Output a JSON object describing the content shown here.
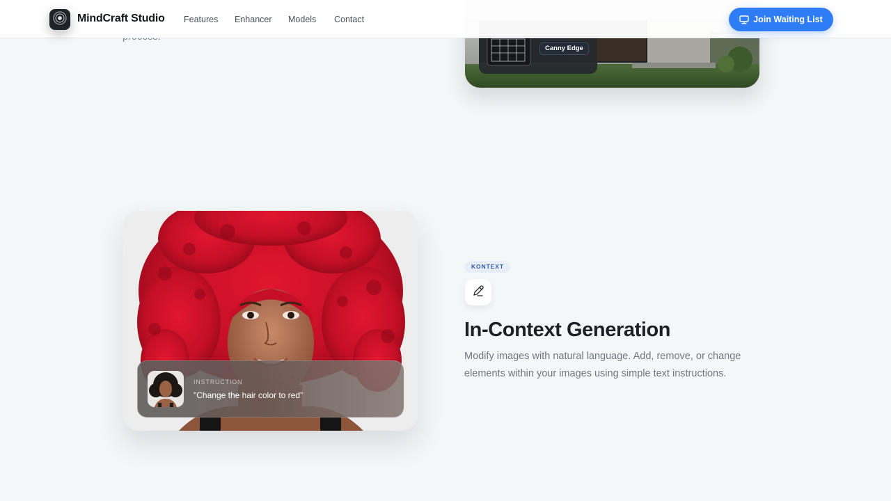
{
  "header": {
    "brand": "MindCraft Studio",
    "nav": [
      "Features",
      "Enhancer",
      "Models",
      "Contact"
    ],
    "cta_label": "Join Waiting List",
    "cta_icon": "monitor-icon",
    "logo_icon": "orb-icon"
  },
  "previous_section": {
    "text_fragment": "process.",
    "image_tag": "Canny Edge"
  },
  "feature": {
    "badge": "KONTEXT",
    "icon": "pencil-icon",
    "title": "In-Context Generation",
    "description": "Modify images with natural language. Add, remove, or change elements within your images using simple text instructions.",
    "instruction_label": "INSTRUCTION",
    "instruction_text": "\"Change the hair color to red\""
  },
  "colors": {
    "accent": "#2e7cf6",
    "page_bg": "#f4f7f8",
    "badge_text": "#2f5fb0",
    "hair_red": "#c8122a"
  }
}
